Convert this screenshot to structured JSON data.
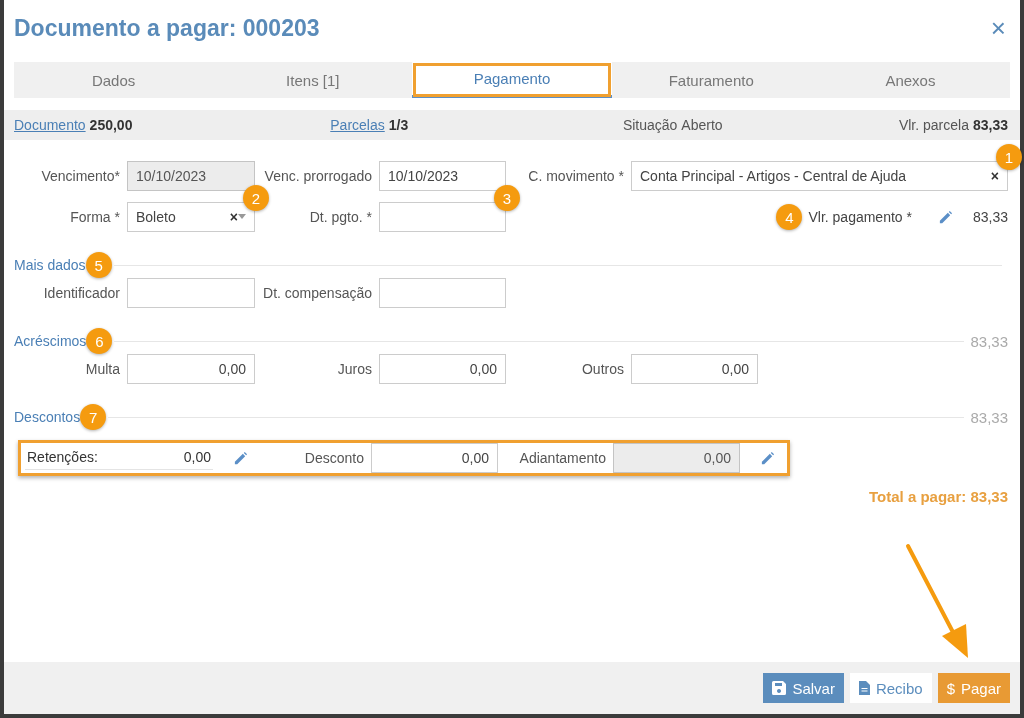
{
  "window": {
    "title": "Documento a pagar: 000203",
    "close": "×"
  },
  "tabs": [
    {
      "label": "Dados",
      "selected": false,
      "highlighted": false
    },
    {
      "label": "Itens [1]",
      "selected": false,
      "highlighted": false
    },
    {
      "label": "Pagamento",
      "selected": true,
      "highlighted": true
    },
    {
      "label": "Faturamento",
      "selected": false,
      "highlighted": false
    },
    {
      "label": "Anexos",
      "selected": false,
      "highlighted": false
    }
  ],
  "summary": [
    {
      "kind": "link",
      "label": "Documento",
      "value": "250,00"
    },
    {
      "kind": "link",
      "label": "Parcelas",
      "value": "1/3"
    },
    {
      "kind": "plain",
      "label": "Situação",
      "value": "Aberto"
    },
    {
      "kind": "amount",
      "label": "Vlr. parcela",
      "value": "83,33"
    }
  ],
  "main_rows": [
    [
      {
        "kind": "input",
        "label": "Vencimento*",
        "value": "10/10/2023",
        "disabled": true
      },
      {
        "kind": "input",
        "label": "Venc. prorrogado",
        "value": "10/10/2023",
        "disabled": false
      },
      {
        "kind": "select",
        "label": "C. movimento *",
        "value": "Conta Principal - Artigos - Central de Ajuda",
        "clear": "×",
        "dropdown": false,
        "marker": "1"
      }
    ],
    [
      {
        "kind": "select",
        "label": "Forma *",
        "value": "Boleto",
        "clear": "×",
        "dropdown": true,
        "marker": "2"
      },
      {
        "kind": "input",
        "label": "Dt. pgto. *",
        "disabled": false,
        "marker": "3"
      },
      {
        "kind": "amount",
        "label": "Vlr. pagamento *",
        "value": "83,33",
        "marker": "4"
      }
    ]
  ],
  "sections": [
    {
      "title": "Mais dados",
      "marker": "5",
      "fields": [
        {
          "label": "Identificador",
          "disabled": false
        },
        {
          "label": "Dt. compensação",
          "disabled": false
        }
      ]
    },
    {
      "title": "Acréscimos",
      "marker": "6",
      "total": "83,33",
      "fields": [
        {
          "label": "Multa",
          "value": "0,00",
          "disabled": false
        },
        {
          "label": "Juros",
          "value": "0,00",
          "disabled": false
        },
        {
          "label": "Outros",
          "value": "0,00",
          "disabled": false
        }
      ]
    }
  ],
  "descontos": {
    "title": "Descontos",
    "marker": "7",
    "total": "83,33",
    "highlighted": true,
    "items": [
      {
        "kind": "readonly",
        "label": "Retenções:",
        "value": "0,00",
        "editable": true
      },
      {
        "kind": "input",
        "label": "Desconto",
        "value": "0,00",
        "disabled": false,
        "editable": false
      },
      {
        "kind": "input",
        "label": "Adiantamento",
        "value": "0,00",
        "disabled": true,
        "editable": true
      }
    ]
  },
  "total": "Total a pagar: 83,33",
  "buttons": [
    {
      "kind": "primary",
      "label": "Salvar"
    },
    {
      "kind": "default",
      "label": "Recibo"
    },
    {
      "kind": "warning",
      "icon": "$",
      "label": "Pagar"
    }
  ]
}
